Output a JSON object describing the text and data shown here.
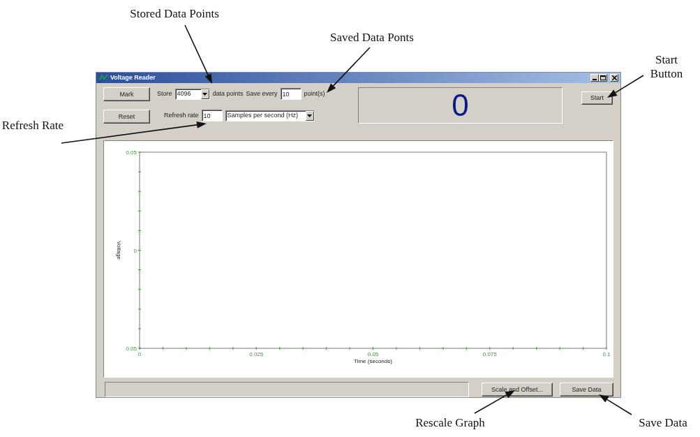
{
  "window": {
    "title": "Voltage Reader"
  },
  "controls": {
    "side_buttons": [
      "Mark",
      "Reset"
    ],
    "store_label": "Store",
    "store_value": "4096",
    "store_unit": "data points",
    "save_every_label": "Save every",
    "save_every_value": "10",
    "save_every_unit": "point(s)",
    "refresh_label": "Refresh rate",
    "refresh_value": "10",
    "refresh_unit": "Samples per second (Hz)"
  },
  "display": {
    "value": "0"
  },
  "start_button": "Start",
  "plot": {
    "chart_data": {
      "type": "line",
      "xlabel": "Time (seconds)",
      "ylabel": "Voltage",
      "xlim": [
        0,
        0.1
      ],
      "ylim": [
        -0.05,
        0.05
      ],
      "xticks": [
        0,
        0.025,
        {
          "value": 0.05,
          "label": "0.05"
        },
        0.075,
        0.1
      ],
      "yticks": [
        {
          "value": 0.05,
          "label": "0.05"
        },
        0,
        {
          "value": -0.05,
          "label": "0.05"
        }
      ]
    }
  },
  "status_bar": {
    "buttons": [
      "Scale and Offset...",
      "Save Data"
    ]
  },
  "annotations": [
    {
      "text": "Stored Data Points"
    },
    {
      "text": "Saved Data Ponts"
    },
    {
      "text": "Start Button"
    },
    {
      "text": "Refresh Rate"
    },
    {
      "text": "Rescale Graph"
    },
    {
      "text": "Save Data"
    }
  ]
}
